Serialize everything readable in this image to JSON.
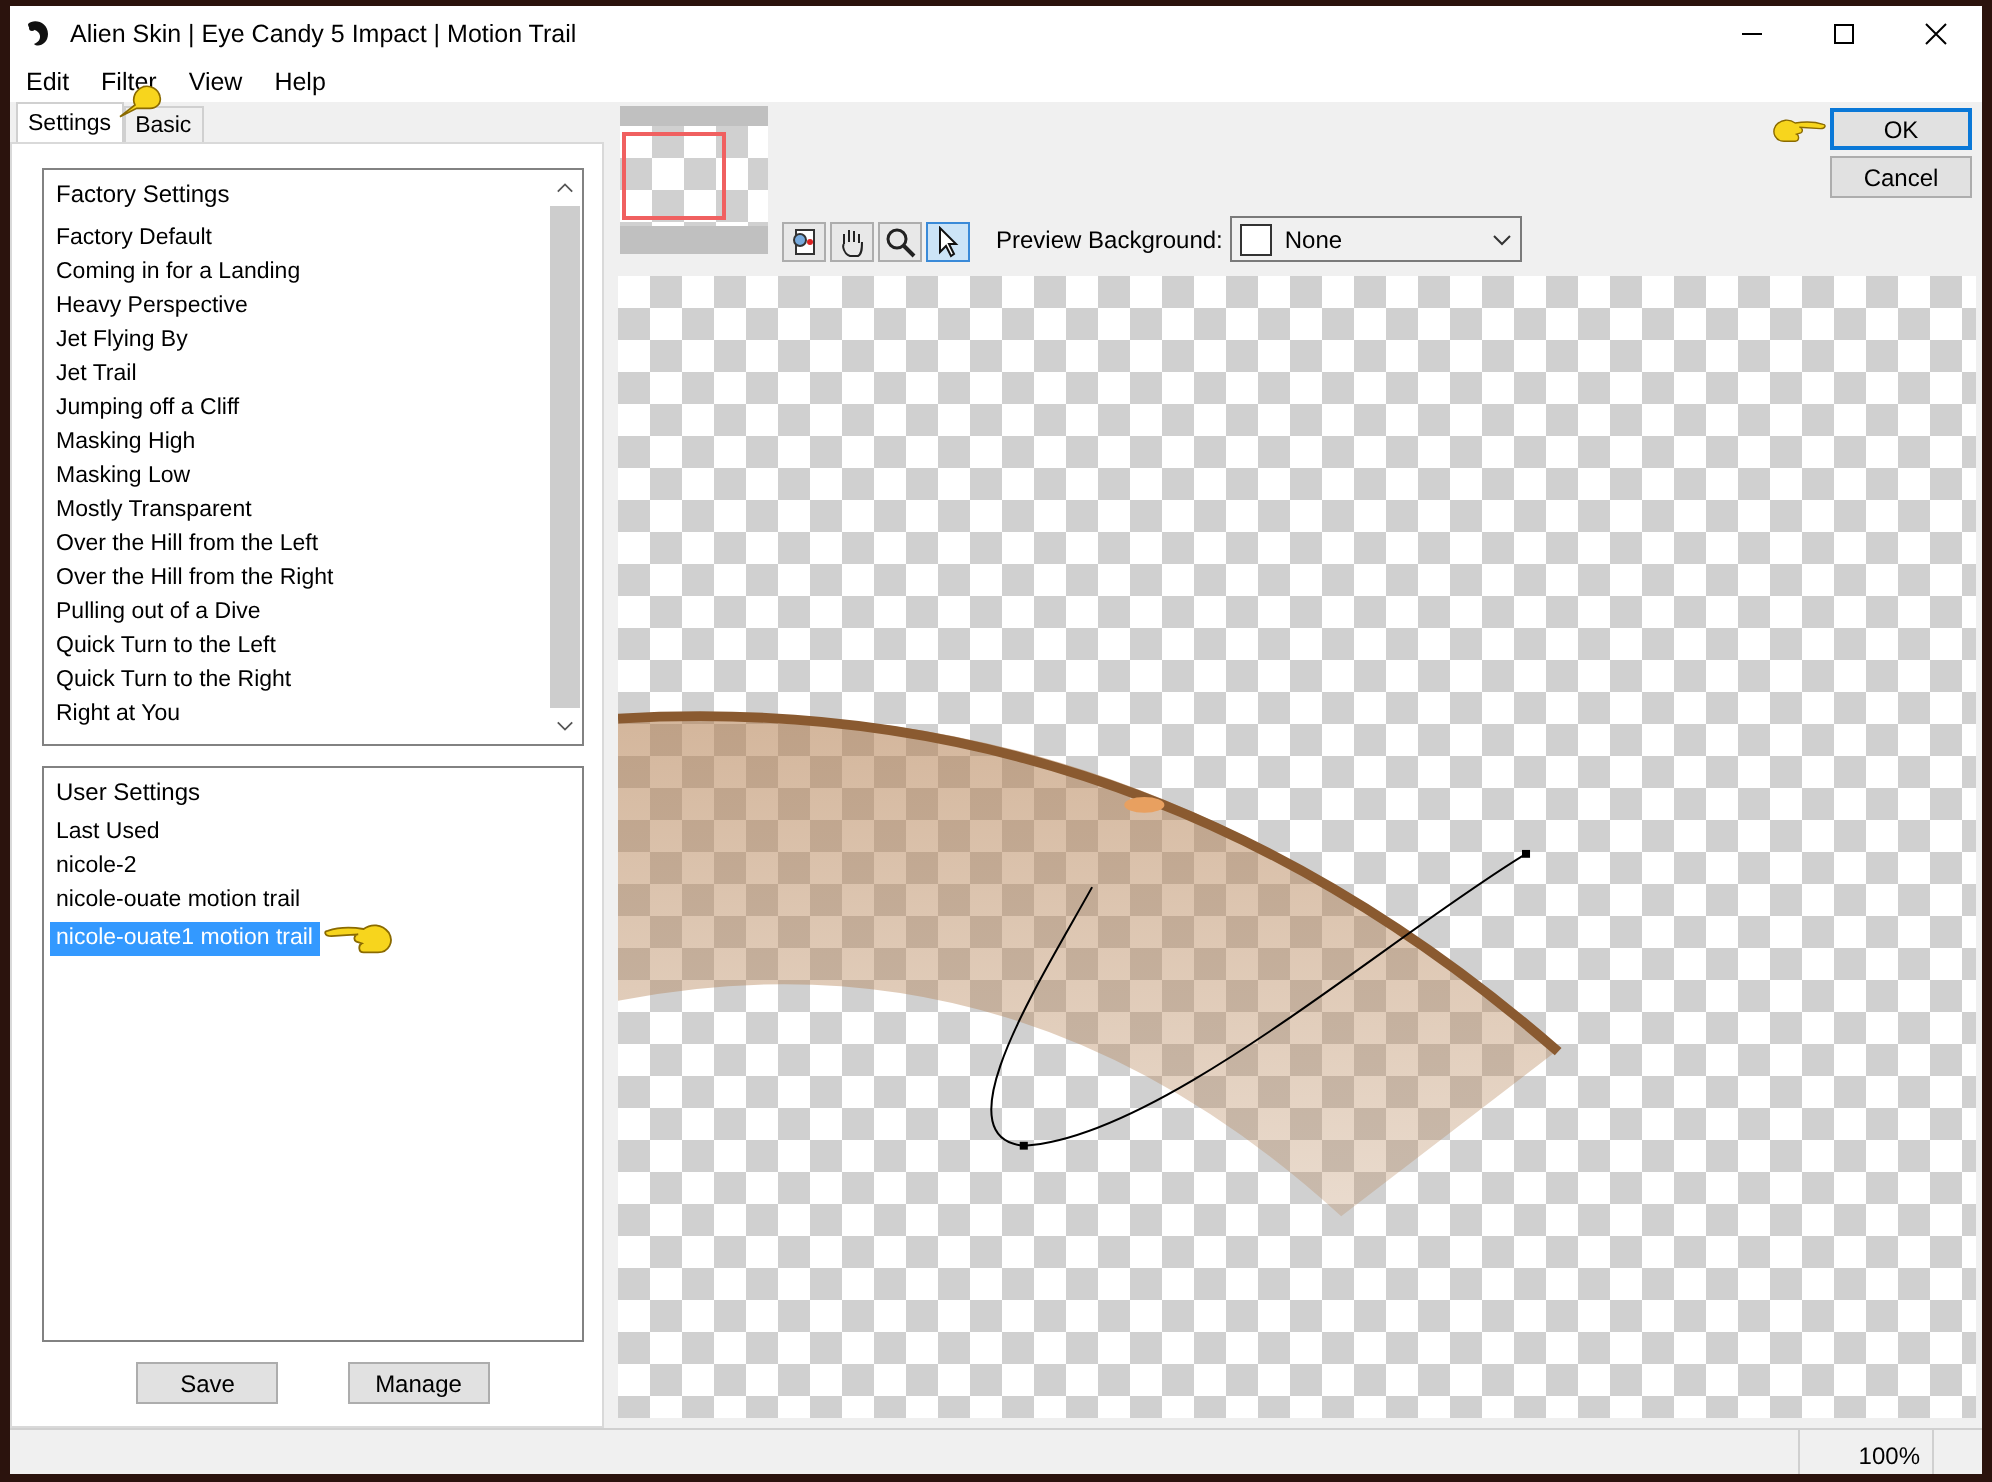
{
  "window": {
    "title": "Alien Skin | Eye Candy 5 Impact | Motion Trail"
  },
  "menu": [
    "Edit",
    "Filter",
    "View",
    "Help"
  ],
  "tabs": [
    {
      "label": "Settings",
      "selected": true
    },
    {
      "label": "Basic",
      "selected": false
    }
  ],
  "factory_settings": {
    "heading": "Factory Settings",
    "items": [
      "Factory Default",
      "Coming in for a Landing",
      "Heavy Perspective",
      "Jet Flying By",
      "Jet Trail",
      "Jumping off a Cliff",
      "Masking High",
      "Masking Low",
      "Mostly Transparent",
      "Over the Hill from the Left",
      "Over the Hill from the Right",
      "Pulling out of a Dive",
      "Quick Turn to the Left",
      "Quick Turn to the Right",
      "Right at You"
    ]
  },
  "user_settings": {
    "heading": "User Settings",
    "items": [
      {
        "label": "Last Used",
        "selected": false
      },
      {
        "label": "nicole-2",
        "selected": false
      },
      {
        "label": "nicole-ouate motion trail",
        "selected": false
      },
      {
        "label": "nicole-ouate1 motion trail",
        "selected": true
      }
    ]
  },
  "settings_buttons": [
    "Save",
    "Manage"
  ],
  "tools": [
    {
      "kind": "preview",
      "selected": false
    },
    {
      "kind": "hand",
      "selected": false
    },
    {
      "kind": "zoom",
      "selected": false
    },
    {
      "kind": "pointer",
      "selected": true
    }
  ],
  "preview_background": {
    "label": "Preview Background:",
    "value": "None"
  },
  "dialog_buttons": [
    {
      "label": "OK",
      "default": true
    },
    {
      "label": "Cancel",
      "default": false
    }
  ],
  "status_bar": {
    "zoom": "100%"
  }
}
